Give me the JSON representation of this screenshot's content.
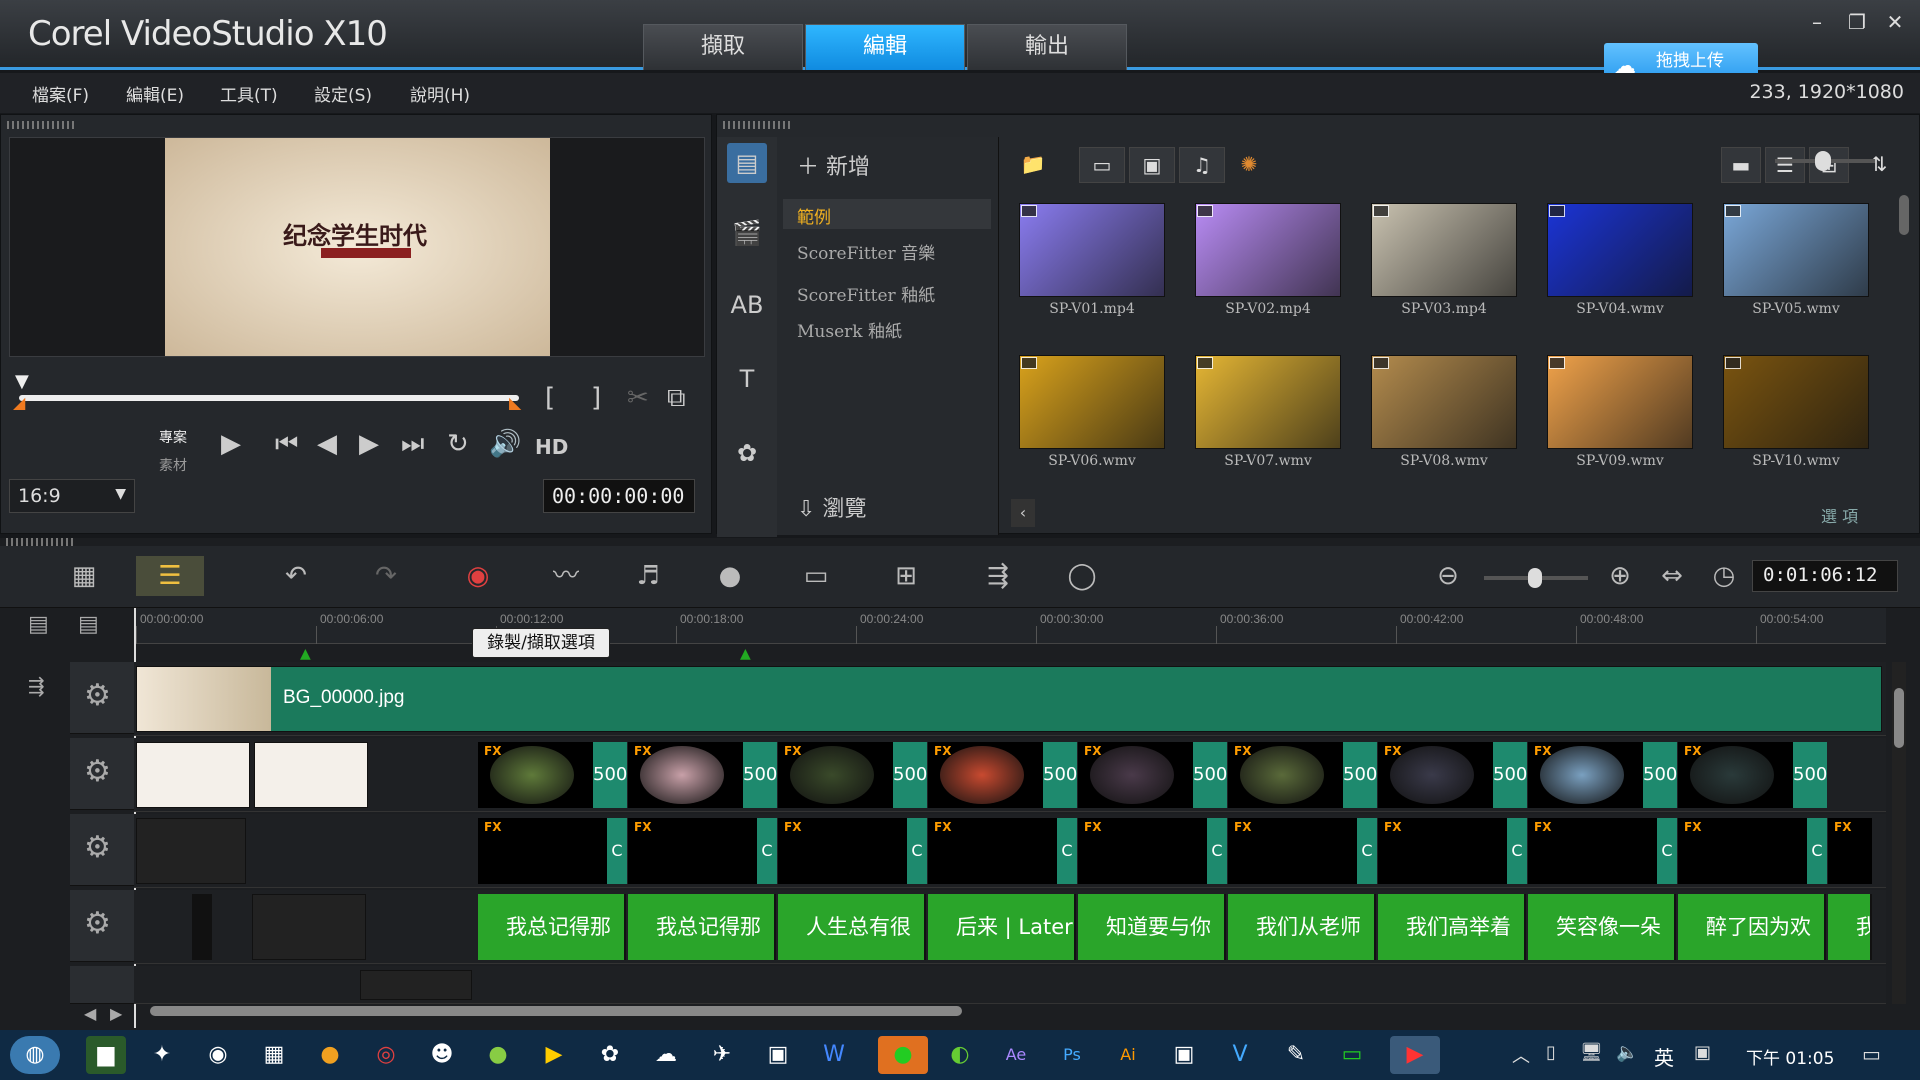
{
  "app": {
    "logo": "Corel VideoStudio X10",
    "tabs": [
      "擷取",
      "編輯",
      "輸出"
    ],
    "active_tab": "編輯",
    "upload": "拖拽上传",
    "resolution": "233, 1920*1080"
  },
  "menu": [
    "檔案(F)",
    "編輯(E)",
    "工具(T)",
    "設定(S)",
    "說明(H)"
  ],
  "player": {
    "frame_title": "纪念学生时代",
    "mode_project": "專案",
    "mode_clip": "素材",
    "hd": "HD",
    "aspect": "16:9",
    "timecode": "00:00:00:00"
  },
  "library": {
    "add": "新增",
    "categories": [
      "範例",
      "ScoreFitter 音樂",
      "ScoreFitter 釉紙",
      "Muserk 釉紙"
    ],
    "browse": "瀏覽",
    "options": "選 項",
    "thumbs": [
      {
        "name": "SP-V01.mp4",
        "color": "#8a7cf0"
      },
      {
        "name": "SP-V02.mp4",
        "color": "#b98cf5"
      },
      {
        "name": "SP-V03.mp4",
        "color": "#c9c2b0"
      },
      {
        "name": "SP-V04.wmv",
        "color": "#1b34d6"
      },
      {
        "name": "SP-V05.wmv",
        "color": "#7aa7d8"
      },
      {
        "name": "SP-V06.wmv",
        "color": "#d9a21c"
      },
      {
        "name": "SP-V07.wmv",
        "color": "#e5b634"
      },
      {
        "name": "SP-V08.wmv",
        "color": "#b38b4d"
      },
      {
        "name": "SP-V09.wmv",
        "color": "#f0a24a"
      },
      {
        "name": "SP-V10.wmv",
        "color": "#7a5410"
      }
    ]
  },
  "timeline": {
    "tooltip": "錄製/擷取選項",
    "time": "0:01:06:12",
    "ruler": [
      "00:00:00:00",
      "00:00:06:00",
      "00:00:12:00",
      "00:00:18:00",
      "00:00:24:00",
      "00:00:30:00",
      "00:00:36:00",
      "00:00:42:00",
      "00:00:48:00",
      "00:00:54:00"
    ],
    "bg_clip": "BG_00000.jpg",
    "overlay_num": "500",
    "overlay_colors": [
      "#5f7a3a",
      "#c8a0a8",
      "#3a4a2a",
      "#c84a30",
      "#4a3a4a",
      "#5a6a3a",
      "#3a3a4a",
      "#7aa0c0",
      "#2a3a3a"
    ],
    "track2_tail": "C",
    "titles": [
      "我总记得那",
      "我总记得那",
      "人生总有很",
      "后来 | Later",
      "知道要与你",
      "我们从老师",
      "我们高举着",
      "笑容像一朵",
      "醉了因为欢",
      "我"
    ]
  },
  "taskbar": {
    "ime": "英",
    "time": "下午 01:05"
  }
}
